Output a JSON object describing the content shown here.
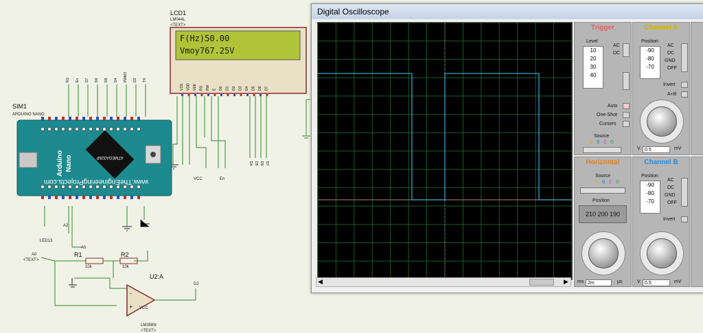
{
  "schematic": {
    "sim_label": "SIM1",
    "sim_sub": "ARDUINO NANO",
    "board_line1": "Arduino",
    "board_line2": "Nano",
    "chip": "ATMEGA328P",
    "site": "www.TheEngineeringProjects.com",
    "lcd_label": "LCD1",
    "lcd_sub": "LM044L",
    "lcd_text": "<TEXT>",
    "lcd_line1": "F(Hz)50.00",
    "lcd_line2": "Vmoy767.25V",
    "lcd_pins": [
      "VSS",
      "VDD",
      "VEE",
      "RS",
      "RW",
      "E",
      "D0",
      "D1",
      "D2",
      "D3",
      "D4",
      "D5",
      "D6",
      "D7"
    ],
    "top_pins": [
      "RS",
      "En",
      "D7",
      "D6",
      "D5",
      "D4",
      "PWM3",
      "D2",
      "TX"
    ],
    "bottom_pins": [
      "LED13",
      "A2",
      "A0"
    ],
    "bus_labels": [
      "D4",
      "D5",
      "D6",
      "D7"
    ],
    "vcc": "VCC",
    "en": "En",
    "r1": "R1",
    "r1_val": "10k",
    "r2": "R2",
    "r2_val": "10k",
    "u2": "U2:A",
    "u2_part": "LM358N",
    "a0": "A0",
    "a2": "A2",
    "text_tag": "<TEXT>",
    "led13": "LED13"
  },
  "oscilloscope": {
    "title": "Digital Oscilloscope",
    "colors": {
      "trace_a": "#3aa0c8",
      "grid": "#1a5a2a",
      "trigger_title": "#e05050",
      "channel_a": "#e0c000",
      "horizontal": "#e08020",
      "channel_b": "#2a8ad8"
    },
    "trigger": {
      "title": "Trigger",
      "level": "Level",
      "scale": [
        "10",
        "20",
        "30",
        "40"
      ],
      "ac": "AC",
      "dc": "DC",
      "auto": "Auto",
      "oneshot": "One-Shot",
      "cursors": "Cursors",
      "source": "Source",
      "src_a": "A",
      "src_b": "B",
      "src_c": "C",
      "src_d": "D"
    },
    "channel_a": {
      "title": "Channel A",
      "position": "Position",
      "scale": [
        "-90",
        "-80",
        "-70"
      ],
      "ac": "AC",
      "dc": "DC",
      "gnd": "GND",
      "off": "OFF",
      "invert": "Invert",
      "apb": "A+B",
      "v": "V",
      "value": "0.5",
      "unit": "mV"
    },
    "horizontal": {
      "title": "Horizontal",
      "source": "Source",
      "src_a": "A",
      "src_b": "B",
      "src_c": "C",
      "src_d": "D",
      "position": "Position",
      "pos_values": [
        "210",
        "200",
        "190"
      ],
      "ms": "ms",
      "value": "2m",
      "unit": "μs"
    },
    "channel_b": {
      "title": "Channel B",
      "position": "Position",
      "scale": [
        "-90",
        "-80",
        "-70"
      ],
      "ac": "AC",
      "dc": "DC",
      "gnd": "GND",
      "off": "OFF",
      "invert": "Invert",
      "v": "V",
      "value": "0.5",
      "unit": "mV"
    }
  }
}
